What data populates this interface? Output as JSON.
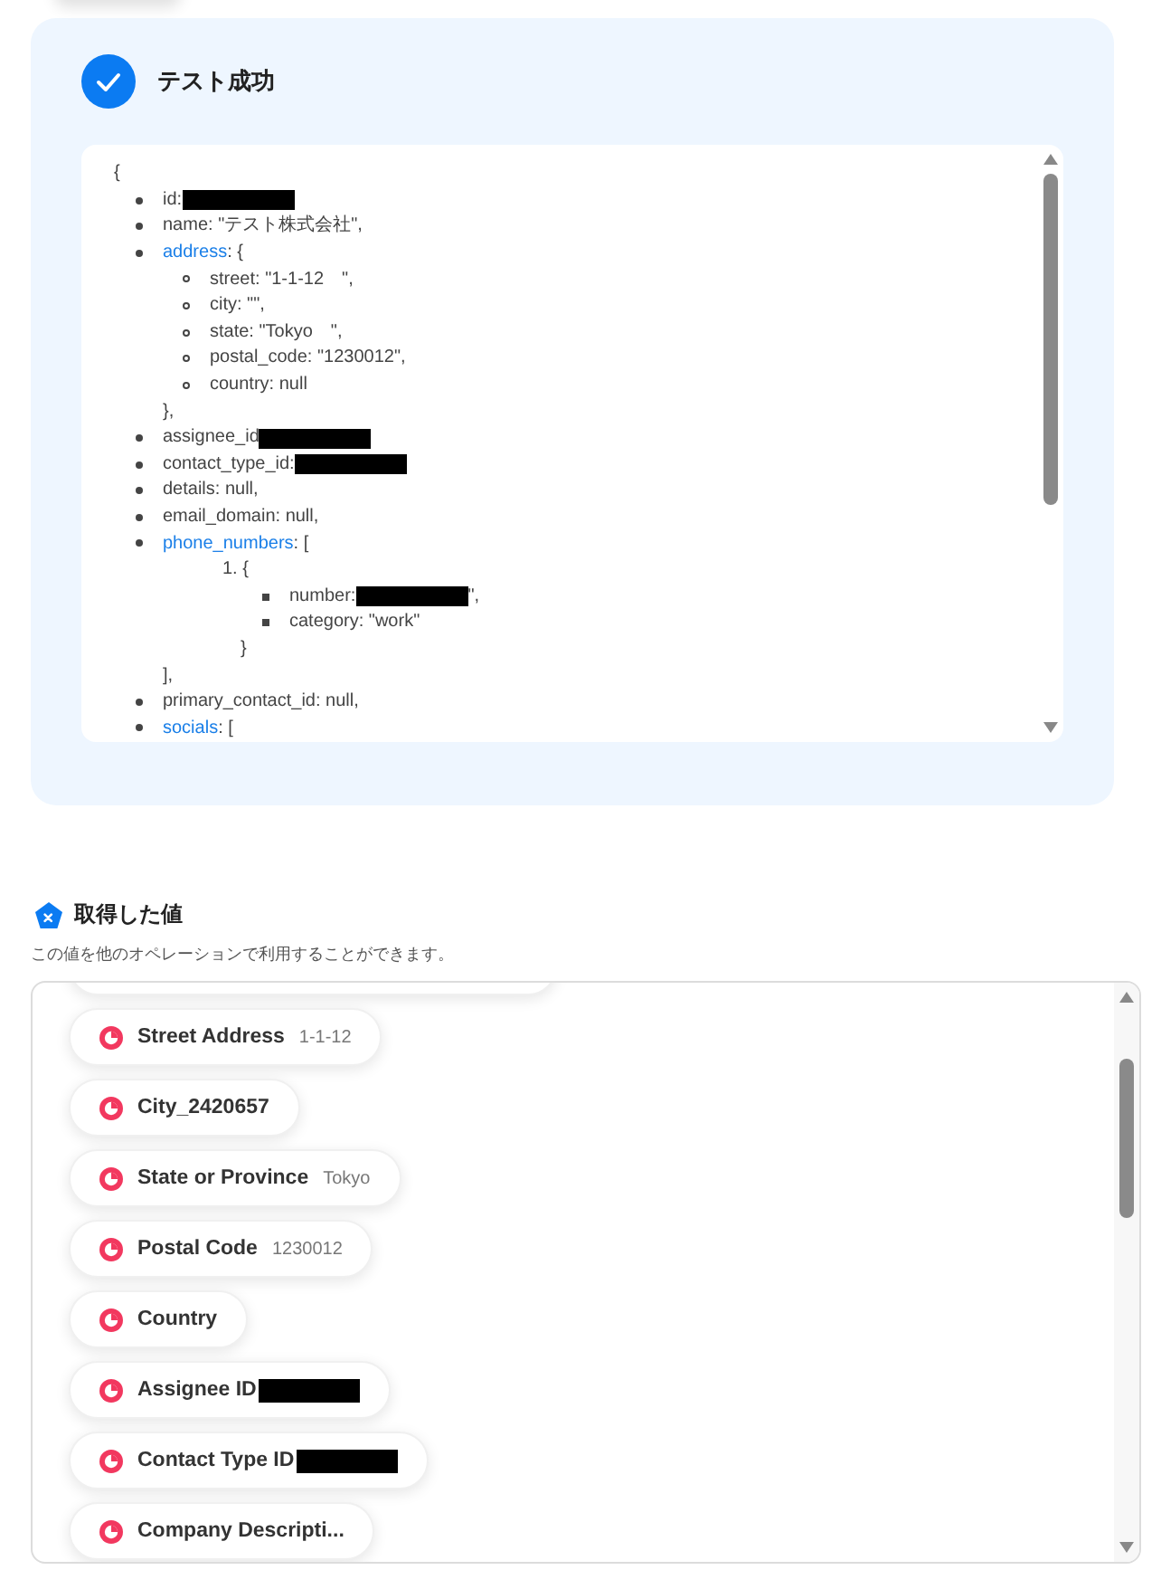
{
  "result": {
    "title": "テスト成功",
    "open_brace": "{",
    "items": [
      {
        "key": "id:",
        "redacted": true
      },
      {
        "key": "name: \"テスト株式会社\","
      },
      {
        "key": "address",
        "link": true,
        "rest": ": {",
        "children": [
          {
            "key": "street: \"1-1-12　\","
          },
          {
            "key": "city: \"\","
          },
          {
            "key": "state: \"Tokyo　\","
          },
          {
            "key": "postal_code: \"1230012\","
          },
          {
            "key": "country: null"
          }
        ],
        "close": "},"
      },
      {
        "key": "assignee_id",
        "redacted": true
      },
      {
        "key": "contact_type_id:",
        "redacted": true
      },
      {
        "key": "details: null,"
      },
      {
        "key": "email_domain: null,"
      },
      {
        "key": "phone_numbers",
        "link": true,
        "rest": ": [",
        "numbered": [
          {
            "number": "1.",
            "key": "{",
            "children": [
              {
                "key": "number:",
                "redacted": true,
                "after": "\","
              },
              {
                "key": "category: \"work\""
              }
            ],
            "close": "}"
          }
        ],
        "close": "],"
      },
      {
        "key": "primary_contact_id: null,"
      },
      {
        "key": "socials",
        "link": true,
        "rest": ": ["
      }
    ]
  },
  "values": {
    "title": "取得した値",
    "description": "この値を他のオペレーションで利用することができます。",
    "chips": [
      {
        "label": "Street Address",
        "value": "1-1-12"
      },
      {
        "label": "City_2420657"
      },
      {
        "label": "State or Province",
        "value": "Tokyo"
      },
      {
        "label": "Postal Code",
        "value": "1230012"
      },
      {
        "label": "Country"
      },
      {
        "label": "Assignee ID",
        "redacted": true
      },
      {
        "label": "Contact Type ID",
        "redacted": true
      },
      {
        "label": "Company Descripti..."
      }
    ]
  }
}
